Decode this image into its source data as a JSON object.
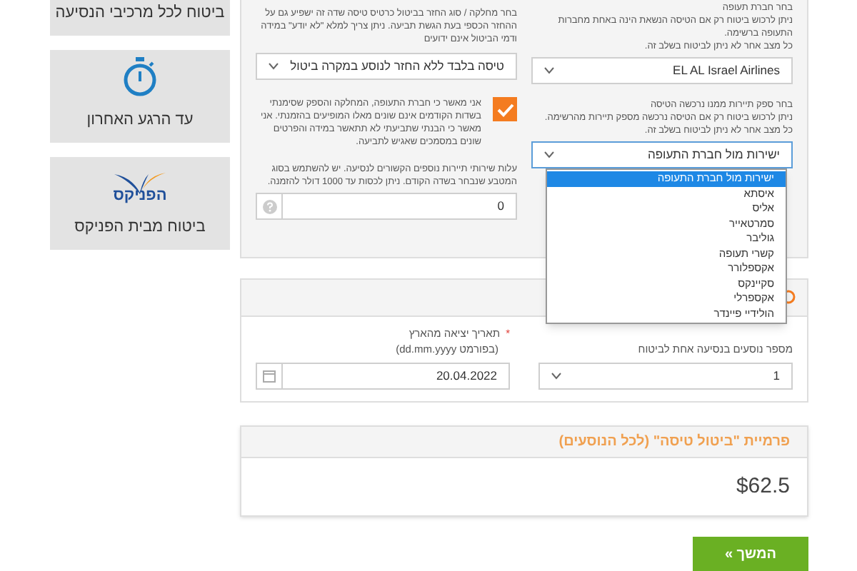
{
  "sidebar": {
    "cards": [
      {
        "kind": "text",
        "label": "ביטוח לכל מרכיבי הנסיעה"
      },
      {
        "kind": "stopwatch",
        "label": "עד הרגע האחרון"
      },
      {
        "kind": "logo",
        "logo_text": "הפניקס",
        "label": "ביטוח מבית הפניקס"
      }
    ]
  },
  "trip_panel": {
    "airline": {
      "lines": [
        "בחר חברת תעופה",
        "ניתן לרכוש ביטוח רק אם הטיסה הנשאת הינה באחת מחברות התעופה ברשימה.",
        "כל מצב אחר לא ניתן לביטוח בשלב זה."
      ],
      "value": "EL AL Israel Airlines"
    },
    "provider": {
      "lines": [
        "בחר ספק תיירות ממנו נרכשה הטיסה",
        "ניתן לרכוש ביטוח רק אם הטיסה נרכשה מספק תיירות מהרשימה.",
        "כל מצב אחר לא ניתן לביטוח בשלב זה."
      ],
      "value": "ישירות מול חברת התעופה",
      "expanded": true,
      "options": [
        {
          "label": "ישירות מול חברת התעופה",
          "selected": true
        },
        {
          "label": "איסתא",
          "selected": false
        },
        {
          "label": "אליס",
          "selected": false
        },
        {
          "label": "סמרטאייר",
          "selected": false
        },
        {
          "label": "גוליבר",
          "selected": false
        },
        {
          "label": "קשרי תעופה",
          "selected": false
        },
        {
          "label": "אקספלורר",
          "selected": false
        },
        {
          "label": "סקיינקס",
          "selected": false
        },
        {
          "label": "אקספרלי",
          "selected": false
        },
        {
          "label": "הולידיי פיינדר",
          "selected": false
        }
      ]
    },
    "refund": {
      "text": "בחר מחלקה / סוג החזר בביטול כרטיס טיסה שדה זה ישפיע גם על ההחזר הכספי בעת הגשת תביעה. ניתן צריך למלא \"לא יודע\" במידה ודמי הביטול אינם ידועים",
      "value": "טיסה בלבד ללא החזר לנוסע במקרה ביטול"
    },
    "confirm": {
      "checked": true,
      "text": "אני מאשר כי חברת התעופה, המחלקה והספק שסימנתי בשדות הקודמים אינם שונים מאלו המופיעים בהזמנתי. אני מאשר כי הבנתי שתביעתי לא תתאשר במידה והפרטים שונים במסמכים שאגיש לתביעה."
    },
    "extra_cost": {
      "text": "עלות שירותי תיירות נוספים הקשורים לנסיעה. יש להשתמש בסוג המטבע שנבחר בשדה הקודם. ניתן לכסות עד 1000 דולר להזמנה.",
      "value": "0"
    }
  },
  "travel_panel": {
    "passengers": {
      "label": "מספר נוסעים בנסיעה אחת לביטוח",
      "value": "1"
    },
    "departure": {
      "required": "*",
      "label": "תאריך יציאה מהארץ",
      "hint": "(בפורמט dd.mm.yyyy)",
      "value": "20.04.2022"
    }
  },
  "premium": {
    "title": "פרמיית \"ביטול טיסה\" (לכל הנוסעים)",
    "amount": "$62.5"
  },
  "continue_button": "המשך »"
}
